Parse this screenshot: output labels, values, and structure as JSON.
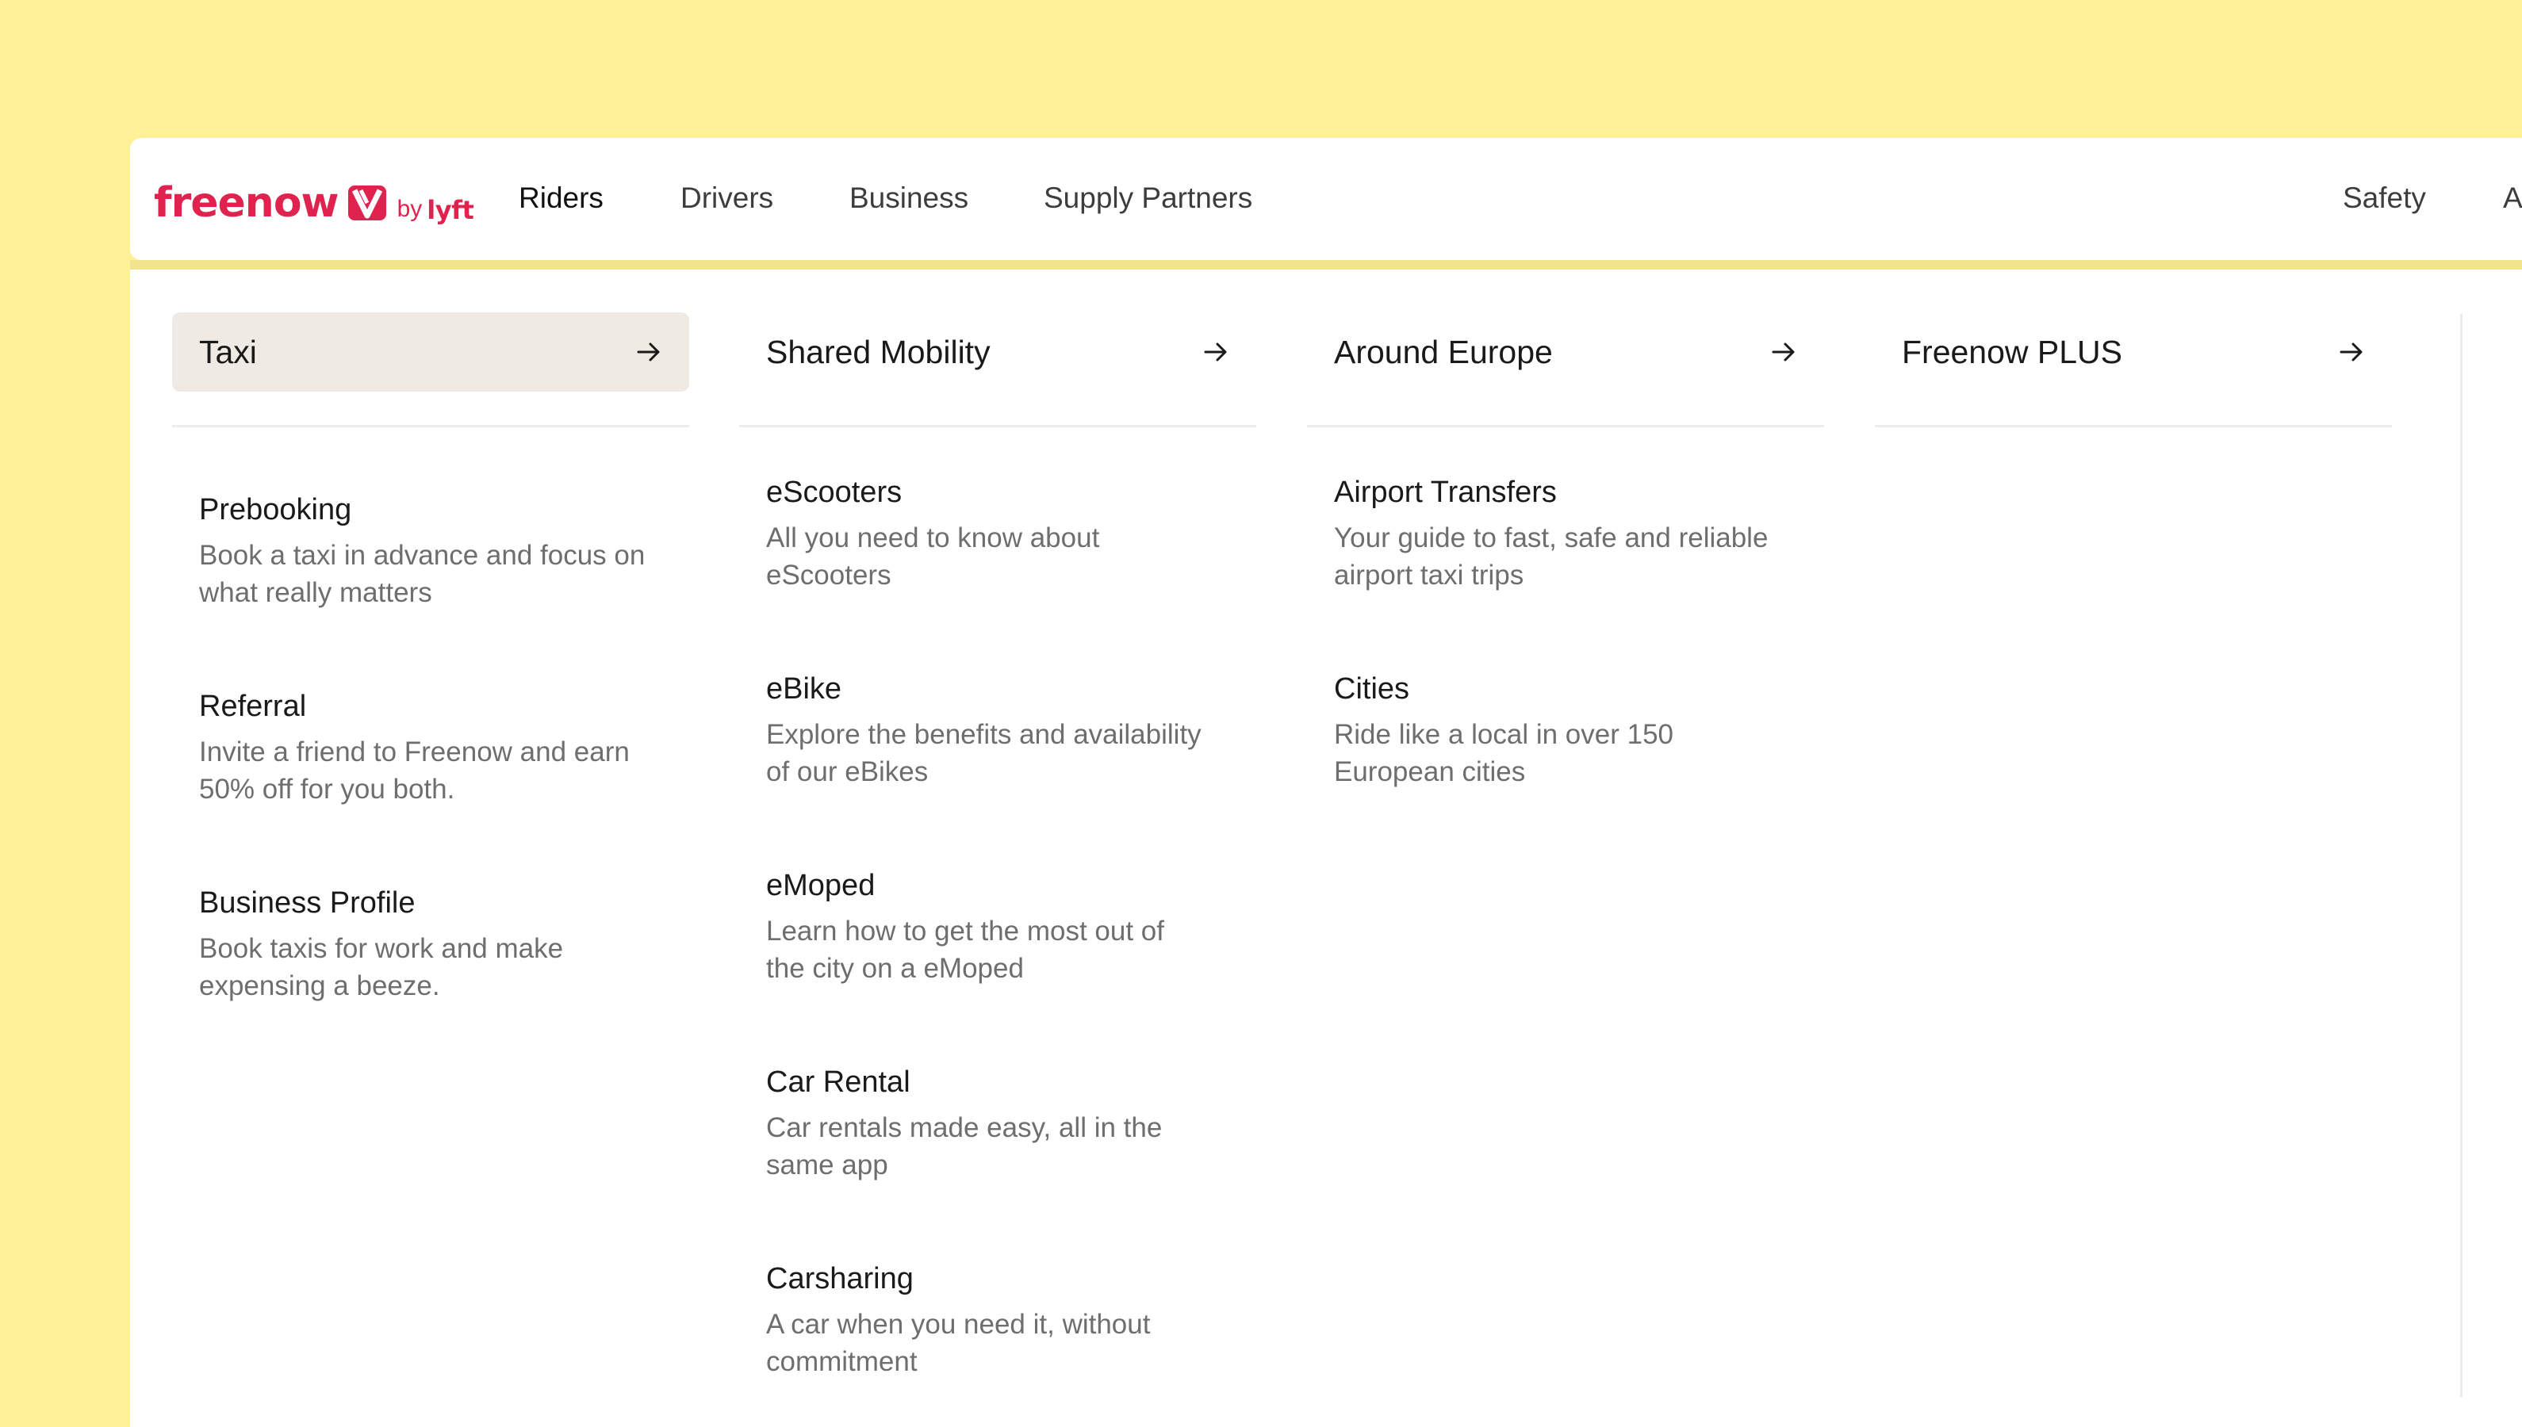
{
  "brand": {
    "name": "freenow",
    "by": "by",
    "partner": "lyft",
    "color": "#e0234e"
  },
  "nav": {
    "items": [
      {
        "label": "Riders"
      },
      {
        "label": "Drivers"
      },
      {
        "label": "Business"
      },
      {
        "label": "Supply Partners"
      }
    ],
    "right_items": [
      {
        "label": "Safety"
      },
      {
        "label": "A"
      }
    ]
  },
  "menu": {
    "columns": [
      {
        "title": "Taxi",
        "arrow_icon": "arrow-right-icon",
        "items": [
          {
            "title": "Prebooking",
            "desc": [
              "Book a taxi in advance and focus on",
              "what really matters"
            ]
          },
          {
            "title": "Referral",
            "desc": [
              "Invite a friend to Freenow and earn",
              "50% off for you both."
            ]
          },
          {
            "title": "Business Profile",
            "desc": [
              "Book taxis for work and make",
              "expensing a beeze."
            ]
          }
        ]
      },
      {
        "title": "Shared Mobility",
        "arrow_icon": "arrow-right-icon",
        "items": [
          {
            "title": "eScooters",
            "desc": [
              "All you need to know about",
              "eScooters"
            ]
          },
          {
            "title": "eBike",
            "desc": [
              "Explore the benefits and availability",
              "of our eBikes"
            ]
          },
          {
            "title": "eMoped",
            "desc": [
              "Learn how to get the most out of",
              "the city on a eMoped"
            ]
          },
          {
            "title": "Car Rental",
            "desc": [
              "Car rentals made easy, all in the",
              "same app"
            ]
          },
          {
            "title": "Carsharing",
            "desc": [
              "A car when you need it, without",
              "commitment"
            ]
          }
        ]
      },
      {
        "title": "Around Europe",
        "arrow_icon": "arrow-right-icon",
        "items": [
          {
            "title": "Airport Transfers",
            "desc": [
              "Your guide to fast, safe and reliable",
              "airport taxi trips"
            ]
          },
          {
            "title": "Cities",
            "desc": [
              "Ride like a local in over 150",
              "European cities"
            ]
          }
        ]
      },
      {
        "title": "Freenow PLUS",
        "arrow_icon": "arrow-right-icon",
        "items": []
      }
    ]
  },
  "colors": {
    "background": "#fff197",
    "active_header": "#efebe4",
    "text_primary": "#1a1a1a",
    "text_secondary": "#6e6e6e"
  }
}
